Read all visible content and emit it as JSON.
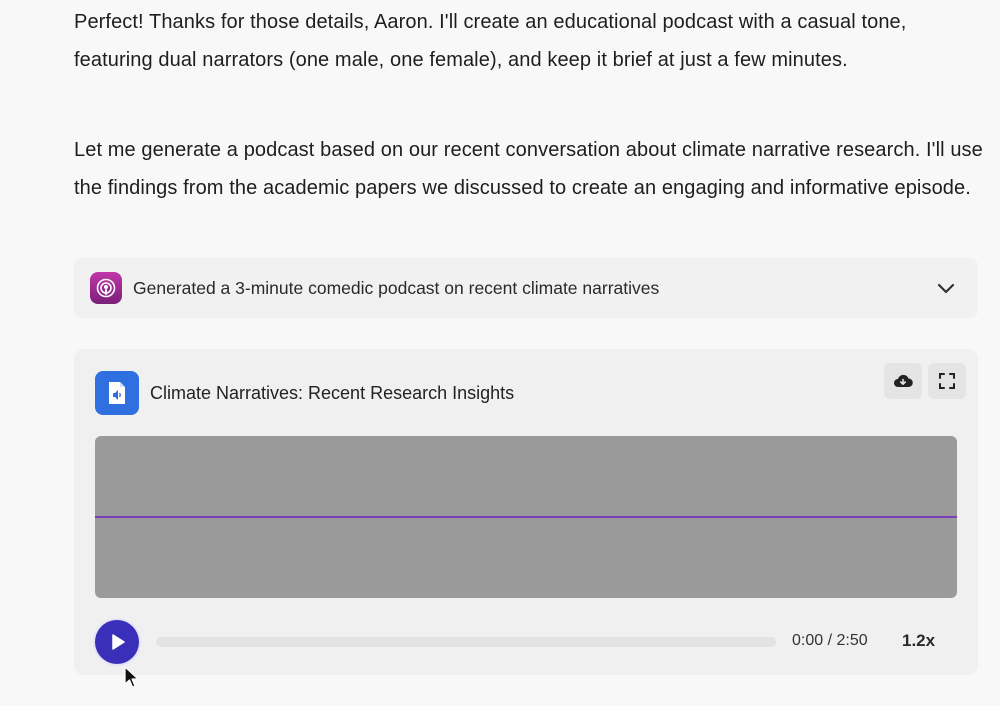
{
  "message": {
    "paragraph1": "Perfect! Thanks for those details, Aaron. I'll create an educational podcast with a casual tone, featuring dual narrators (one male, one female), and keep it brief at just a few minutes.",
    "paragraph2": "Let me generate a podcast based on our recent conversation about climate narrative research. I'll use the findings from the academic papers we discussed to create an engaging and informative episode."
  },
  "tool_result": {
    "icon": "podcast-icon",
    "label": "Generated a 3-minute comedic podcast on recent climate narratives",
    "expand_icon": "chevron-down-icon"
  },
  "player": {
    "file_icon": "audio-file-icon",
    "title": "Climate Narratives: Recent Research Insights",
    "actions": {
      "download_icon": "cloud-download-icon",
      "fullscreen_icon": "fullscreen-icon"
    },
    "time": "0:00 / 2:50",
    "progress": 0,
    "speed": "1.2x",
    "play_icon": "play-icon"
  },
  "colors": {
    "accent": "#3a2fb8",
    "waveform_bg": "#9a9a9a",
    "waveform_line": "#7a3fb8",
    "file_icon_bg": "#2f6fe0",
    "podcast_icon_bg": "#b0309a"
  }
}
